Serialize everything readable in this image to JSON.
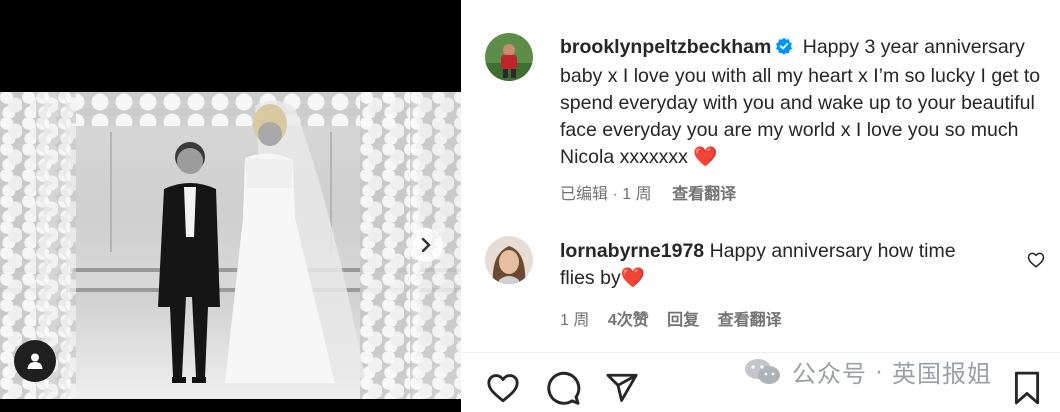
{
  "post": {
    "author": "brooklynpeltzbeckham",
    "caption": "Happy 3 year anniversary baby x I love you with all my heart x I’m so lucky I get to spend everyday with you and wake up to your beautiful face everyday you are my world x I love you so much Nicola xxxxxxx",
    "caption_emoji": "❤️",
    "edited_label": "已编辑",
    "time": "1 周",
    "translate_label": "查看翻译"
  },
  "comment": {
    "author": "lornabyrne1978",
    "text": "Happy anniversary how time flies by",
    "emoji": "❤️",
    "time": "1 周",
    "likes": "4次赞",
    "reply_label": "回复",
    "translate_label": "查看翻译"
  },
  "watermark": {
    "source": "公众号",
    "separator": "·",
    "account": "英国报姐"
  },
  "icons": {
    "verified": "verified-badge-icon",
    "next": "chevron-right-icon",
    "tags": "user-tag-icon",
    "like": "heart-outline-icon",
    "comment": "comment-bubble-icon",
    "share": "paper-plane-icon",
    "save": "bookmark-icon",
    "comment_like": "heart-outline-icon"
  },
  "colors": {
    "verified_blue": "#0095f6",
    "heart_red": "#e0245e",
    "text_primary": "#262626",
    "text_secondary": "#737373"
  }
}
